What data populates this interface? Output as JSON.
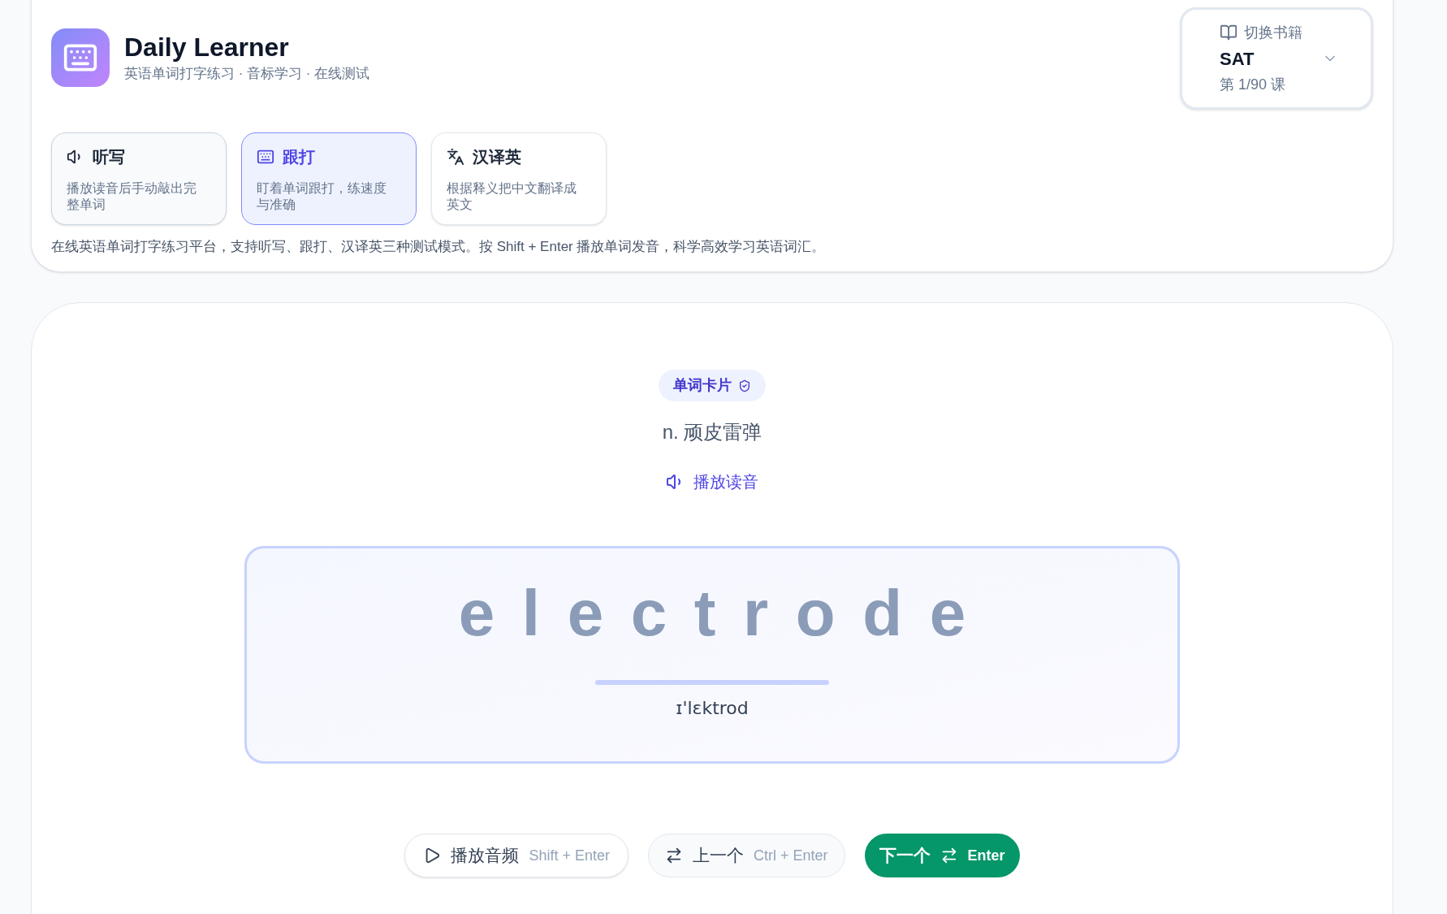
{
  "app": {
    "title": "Daily Learner",
    "subtitle": "英语单词打字练习 · 音标学习 · 在线测试"
  },
  "book": {
    "label": "切换书籍",
    "name": "SAT",
    "lesson": "第 1/90 课"
  },
  "modes": [
    {
      "kind": "dictation",
      "title": "听写",
      "description": "播放读音后手动敲出完整单词",
      "selected": false
    },
    {
      "kind": "typing",
      "title": "跟打",
      "description": "盯着单词跟打，练速度与准确",
      "selected": true
    },
    {
      "kind": "translate",
      "title": "汉译英",
      "description": "根据释义把中文翻译成英文",
      "selected": false
    }
  ],
  "intro": "在线英语单词打字练习平台，支持听写、跟打、汉译英三种测试模式。按 Shift + Enter 播放单词发音，科学高效学习英语词汇。",
  "card": {
    "badge": "单词卡片",
    "definition": "n. 顽皮雷弹",
    "play": "播放读音",
    "word": "electrode",
    "phonetic": "ɪ'lɛktrod"
  },
  "actions": [
    {
      "kind": "play",
      "label": "播放音频",
      "shortcut": "Shift + Enter"
    },
    {
      "kind": "prev",
      "label": "上一个",
      "shortcut": "Ctrl + Enter"
    },
    {
      "kind": "next",
      "label": "下一个",
      "shortcut": "Enter"
    }
  ]
}
